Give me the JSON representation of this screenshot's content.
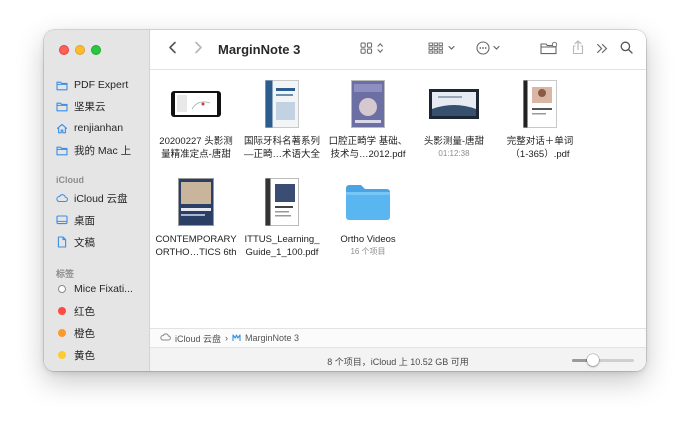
{
  "window": {
    "title": "MarginNote 3"
  },
  "sidebar": {
    "favorites": [
      {
        "label": "PDF Expert",
        "icon": "folder-icon"
      },
      {
        "label": "坚果云",
        "icon": "folder-icon"
      },
      {
        "label": "renjianhan",
        "icon": "home-icon"
      },
      {
        "label": "我的 Mac 上",
        "icon": "folder-icon"
      }
    ],
    "icloud_heading": "iCloud",
    "icloud": [
      {
        "label": "iCloud 云盘",
        "icon": "cloud-icon"
      },
      {
        "label": "桌面",
        "icon": "desktop-icon"
      },
      {
        "label": "文稿",
        "icon": "document-icon"
      }
    ],
    "tags_heading": "标签",
    "tags": [
      {
        "label": "Mice Fixati...",
        "color": "#ffffff"
      },
      {
        "label": "红色",
        "color": "#fe4a3f"
      },
      {
        "label": "橙色",
        "color": "#fc9a2b"
      },
      {
        "label": "黄色",
        "color": "#fdcb2e"
      }
    ]
  },
  "files": [
    {
      "line1": "20200227 头影测",
      "line2": "量精准定点-唐甜",
      "sub": ""
    },
    {
      "line1": "国际牙科名著系列",
      "line2": "—正畸…术语大全",
      "sub": ""
    },
    {
      "line1": "口腔正畸学 基础、",
      "line2": "技术与…2012.pdf",
      "sub": ""
    },
    {
      "line1": "头影测量-唐甜",
      "line2": "",
      "sub": "01:12:38"
    },
    {
      "line1": "完整对话＋单词",
      "line2": "（1-365）.pdf",
      "sub": ""
    },
    {
      "line1": "CONTEMPORARY",
      "line2": "ORTHO…TICS 6th",
      "sub": ""
    },
    {
      "line1": "ITTUS_Learning_",
      "line2": "Guide_1_100.pdf",
      "sub": ""
    },
    {
      "line1": "Ortho Videos",
      "line2": "",
      "sub": "16 个项目"
    }
  ],
  "book_text": {
    "dental_title": "口腔正畸学",
    "contemporary": "CONTEMPORARY ORTHODONTICS"
  },
  "pathbar": {
    "root": "iCloud 云盘",
    "separator": "›",
    "current": "MarginNote 3"
  },
  "status": {
    "text": "8 个项目，iCloud 上 10.52 GB 可用",
    "zoom": 0.3
  },
  "colors": {
    "folder_blue": "#5ab6f0",
    "sidebar_icon": "#3a8ee6"
  }
}
